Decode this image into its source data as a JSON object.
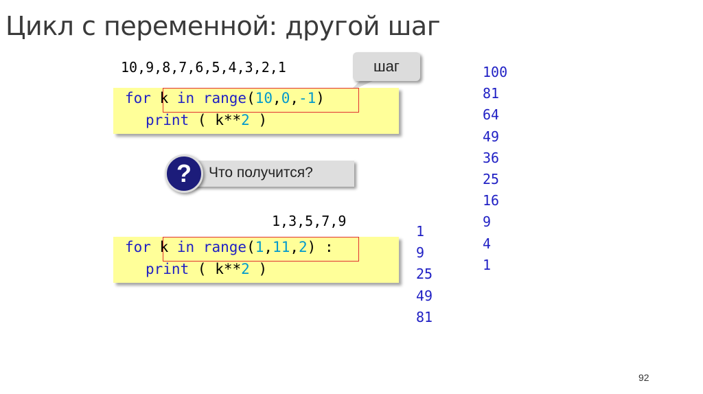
{
  "title": "Цикл с переменной: другой шаг",
  "example1": {
    "sequence": "10,9,8,7,6,5,4,3,2,1",
    "callout": "шаг",
    "line1": {
      "kw": "for",
      "var": "k",
      "in": "in",
      "fn": "range",
      "open": "(",
      "a": "10",
      "c1": ",",
      "b": "0",
      "c2": ",",
      "step": "-1",
      "close": ")"
    },
    "line2": {
      "fn": "print",
      "open": "(",
      "expr": "k**",
      "pow": "2",
      "close": ")"
    },
    "output": [
      "100",
      "81",
      "64",
      "49",
      "36",
      "25",
      "16",
      "9",
      "4",
      "1"
    ]
  },
  "question": {
    "icon_glyph": "?",
    "text": "Что получится?"
  },
  "example2": {
    "sequence": "1,3,5,7,9",
    "line1": {
      "kw": "for",
      "var": "k",
      "in": "in",
      "fn": "range",
      "open": "(",
      "a": "1",
      "c1": ",",
      "b": "11",
      "c2": ",",
      "step": "2",
      "close": ")",
      "colon": ":"
    },
    "line2": {
      "fn": "print",
      "open": "(",
      "expr": "k**",
      "pow": "2",
      "close": ")"
    },
    "output": [
      "1",
      "9",
      "25",
      "49",
      "81"
    ]
  },
  "page_number": "92",
  "colors": {
    "keyword": "#1f1fc4",
    "number": "#0099cc",
    "code_bg": "#ffff99",
    "frame": "#e03030",
    "question_circle": "#1c1c7a"
  }
}
